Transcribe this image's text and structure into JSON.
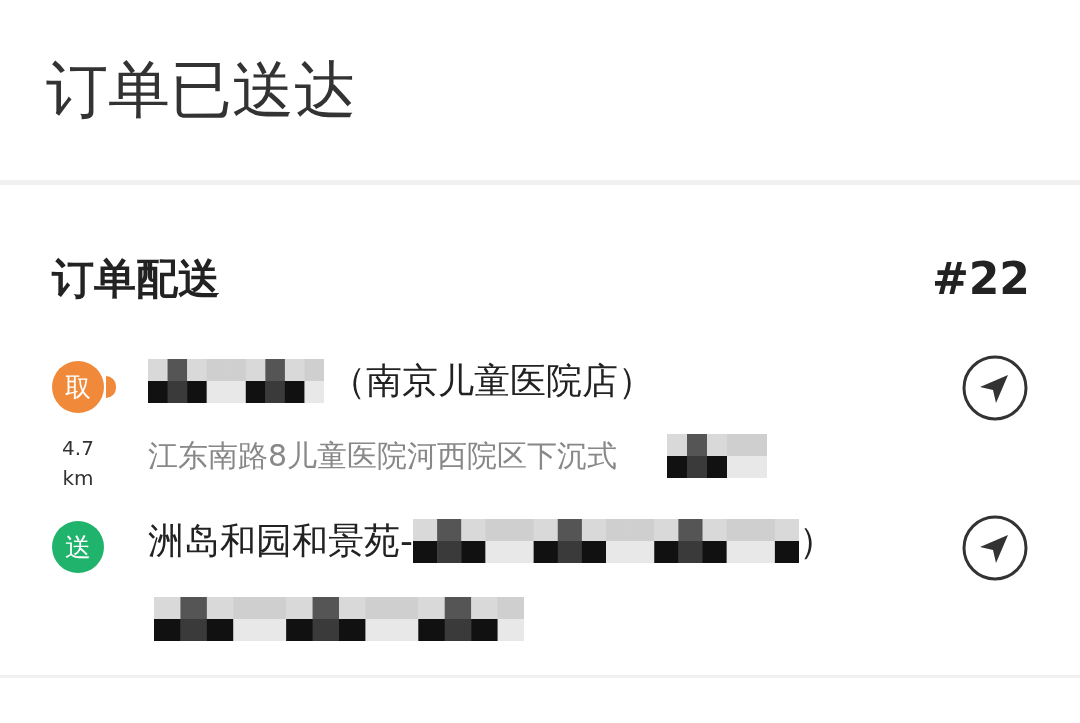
{
  "header": {
    "title": "订单已送达"
  },
  "section": {
    "title": "订单配送",
    "order_number": "#22"
  },
  "stops": [
    {
      "kind": "pickup",
      "badge": "取",
      "name_suffix": "（南京儿童医院店）",
      "address": "江东南路8儿童医院河西院区下沉式",
      "distance": "4.7",
      "distance_unit": "km"
    },
    {
      "kind": "dropoff",
      "badge": "送",
      "name_prefix": "洲岛和园和景苑-",
      "name_suffix": "）"
    }
  ]
}
